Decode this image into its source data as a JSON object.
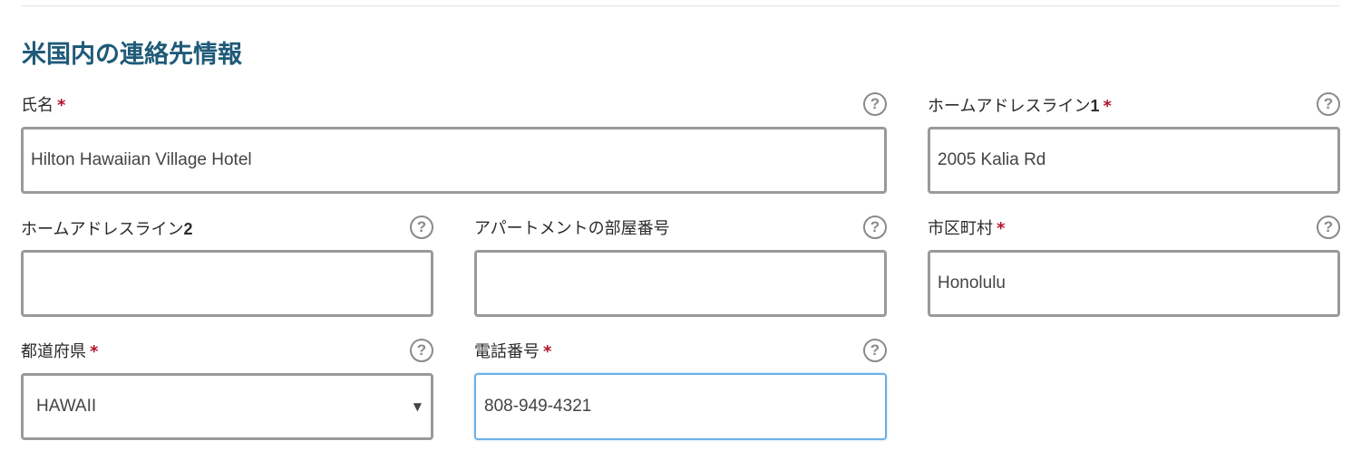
{
  "section": {
    "title": "米国内の連絡先情報"
  },
  "help_glyph": "?",
  "required_mark": "*",
  "fields": {
    "full_name": {
      "label": "氏名",
      "value": "Hilton Hawaiian Village Hotel",
      "required": true
    },
    "address_line1": {
      "label_text": "ホームアドレスライン",
      "label_num": "1",
      "value": "2005 Kalia Rd",
      "required": true
    },
    "address_line2": {
      "label_text": "ホームアドレスライン",
      "label_num": "2",
      "value": "",
      "required": false
    },
    "apartment": {
      "label": "アパートメントの部屋番号",
      "value": "",
      "required": false
    },
    "city": {
      "label": "市区町村",
      "value": "Honolulu",
      "required": true
    },
    "state": {
      "label": "都道府県",
      "selected": "HAWAII",
      "arrow": "▼",
      "required": true
    },
    "phone": {
      "label": "電話番号",
      "value": "808-949-4321",
      "required": true,
      "focused": true
    }
  },
  "colors": {
    "title": "#1f5a78",
    "required": "#b3122b",
    "border": "#9a9a9a",
    "focus_border": "#6ab0e6",
    "help_icon": "#8a8a8a"
  }
}
